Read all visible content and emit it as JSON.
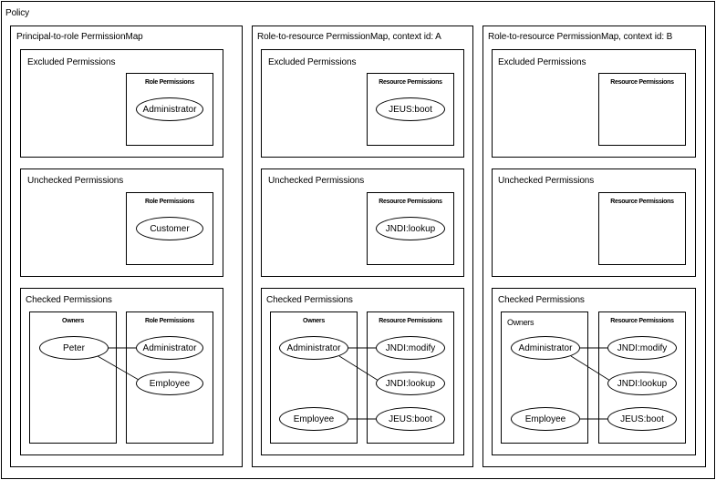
{
  "policy": {
    "title": "Policy",
    "maps": [
      {
        "title": "Principal-to-role PermissionMap",
        "excluded": {
          "title": "Excluded Permissions",
          "panel_title": "Role Permissions",
          "items": [
            "Administrator"
          ]
        },
        "unchecked": {
          "title": "Unchecked Permissions",
          "panel_title": "Role Permissions",
          "items": [
            "Customer"
          ]
        },
        "checked": {
          "title": "Checked Permissions",
          "owners_title": "Owners",
          "owners": [
            "Peter"
          ],
          "panel_title": "Role Permissions",
          "items": [
            "Administrator",
            "Employee"
          ],
          "links": [
            [
              "Peter",
              "Administrator"
            ],
            [
              "Peter",
              "Employee"
            ]
          ]
        }
      },
      {
        "title": "Role-to-resource PermissionMap, context id: A",
        "excluded": {
          "title": "Excluded Permissions",
          "panel_title": "Resource Permissions",
          "items": [
            "JEUS:boot"
          ]
        },
        "unchecked": {
          "title": "Unchecked Permissions",
          "panel_title": "Resource Permissions",
          "items": [
            "JNDI:lookup"
          ]
        },
        "checked": {
          "title": "Checked Permissions",
          "owners_title": "Owners",
          "owners": [
            "Administrator",
            "Employee"
          ],
          "panel_title": "Resource Permissions",
          "items": [
            "JNDI:modify",
            "JNDI:lookup",
            "JEUS:boot"
          ],
          "links": [
            [
              "Administrator",
              "JNDI:modify"
            ],
            [
              "Administrator",
              "JNDI:lookup"
            ],
            [
              "Employee",
              "JEUS:boot"
            ]
          ]
        }
      },
      {
        "title": "Role-to-resource PermissionMap, context id: B",
        "excluded": {
          "title": "Excluded Permissions",
          "panel_title": "Resource Permissions",
          "items": []
        },
        "unchecked": {
          "title": "Unchecked Permissions",
          "panel_title": "Resource Permissions",
          "items": []
        },
        "checked": {
          "title": "Checked Permissions",
          "owners_title": "Owners",
          "owners": [
            "Administrator",
            "Employee"
          ],
          "panel_title": "Resource Permissions",
          "items": [
            "JNDI:modify",
            "JNDI:lookup",
            "JEUS:boot"
          ],
          "links": [
            [
              "Administrator",
              "JNDI:modify"
            ],
            [
              "Administrator",
              "JNDI:lookup"
            ],
            [
              "Employee",
              "JEUS:boot"
            ]
          ]
        }
      }
    ]
  }
}
